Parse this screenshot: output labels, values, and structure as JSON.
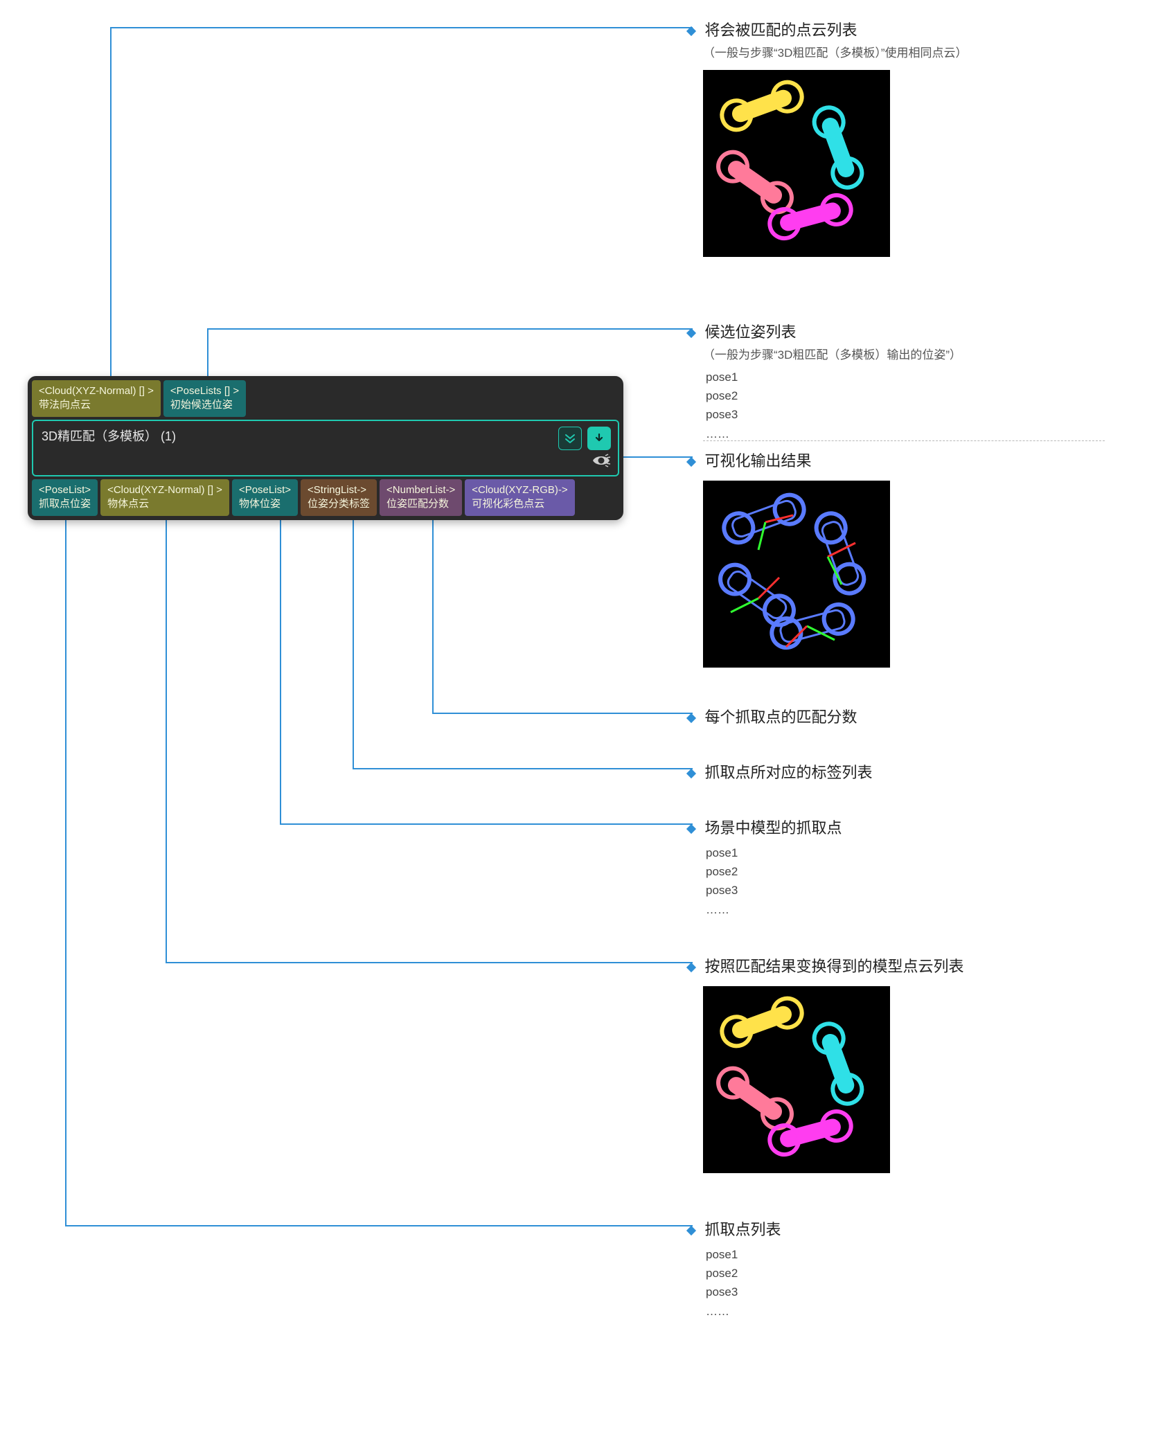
{
  "node": {
    "title": "3D精匹配（多模板） (1)",
    "inputs": [
      {
        "type": "<Cloud(XYZ-Normal) [] >",
        "label": "带法向点云",
        "color": "olive"
      },
      {
        "type": "<PoseLists [] >",
        "label": "初始候选位姿",
        "color": "teal"
      }
    ],
    "outputs": [
      {
        "type": "<PoseList>",
        "label": "抓取点位姿",
        "color": "teal"
      },
      {
        "type": "<Cloud(XYZ-Normal) [] >",
        "label": "物体点云",
        "color": "olive"
      },
      {
        "type": "<PoseList>",
        "label": "物体位姿",
        "color": "teal"
      },
      {
        "type": "<StringList->",
        "label": "位姿分类标签",
        "color": "brown"
      },
      {
        "type": "<NumberList->",
        "label": "位姿匹配分数",
        "color": "plum"
      },
      {
        "type": "<Cloud(XYZ-RGB)->",
        "label": "可视化彩色点云",
        "color": "purple"
      }
    ]
  },
  "annos": {
    "a1": {
      "title": "将会被匹配的点云列表",
      "sub": "（一般与步骤“3D粗匹配（多模板）”使用相同点云）"
    },
    "a2": {
      "title": "候选位姿列表",
      "sub": "（一般为步骤“3D粗匹配（多模板）输出的位姿”）",
      "poses": [
        "pose1",
        "pose2",
        "pose3",
        "……"
      ]
    },
    "a3": {
      "title": "可视化输出结果"
    },
    "a4": {
      "title": "每个抓取点的匹配分数"
    },
    "a5": {
      "title": "抓取点所对应的标签列表"
    },
    "a6": {
      "title": "场景中模型的抓取点",
      "poses": [
        "pose1",
        "pose2",
        "pose3",
        "……"
      ]
    },
    "a7": {
      "title": "按照匹配结果变换得到的模型点云列表"
    },
    "a8": {
      "title": "抓取点列表",
      "poses": [
        "pose1",
        "pose2",
        "pose3",
        "……"
      ]
    }
  }
}
